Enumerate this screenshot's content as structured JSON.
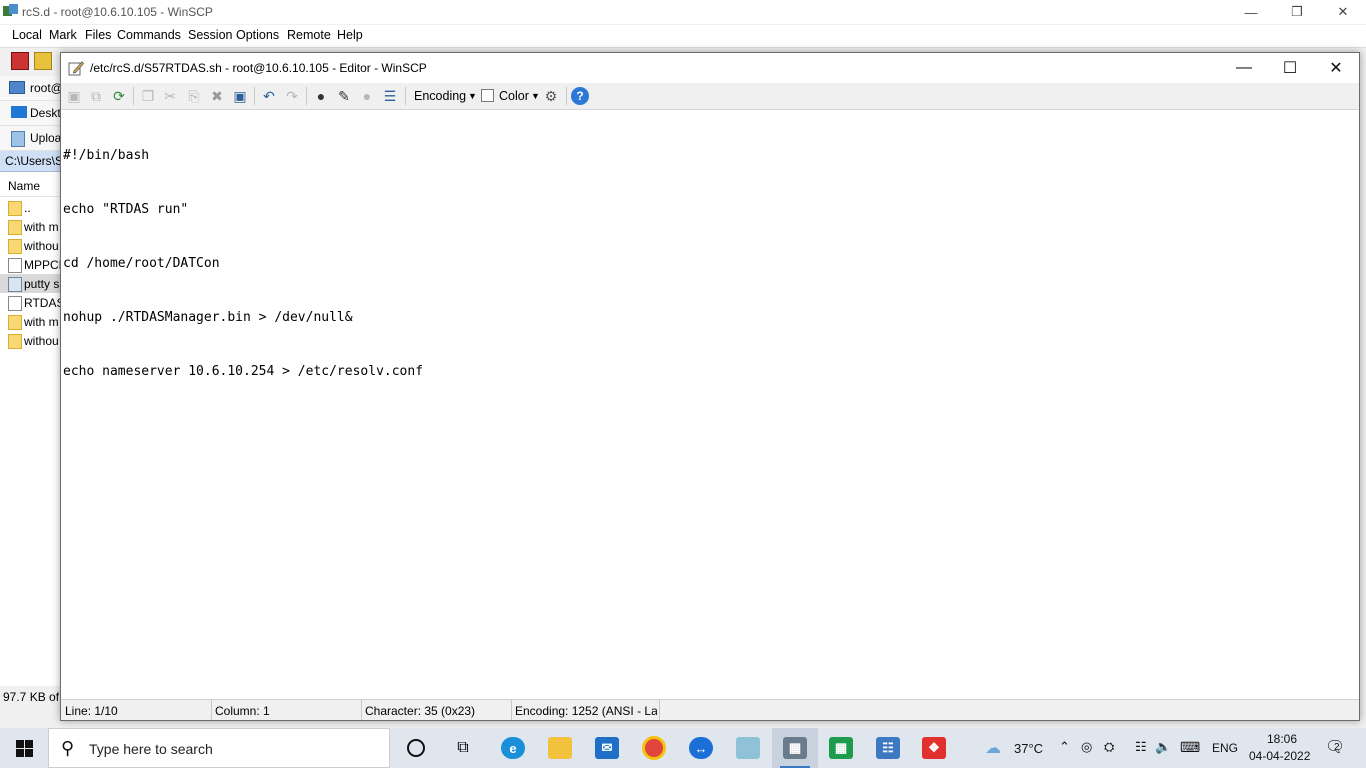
{
  "main_window": {
    "title": "rcS.d - root@10.6.10.105 - WinSCP",
    "menu": [
      "Local",
      "Mark",
      "Files",
      "Commands",
      "Session",
      "Options",
      "Remote",
      "Help"
    ],
    "left_rows": [
      "root@",
      "Deskt",
      "Uploa"
    ],
    "path": "C:\\Users\\S",
    "name_header": "Name",
    "files": [
      {
        "name": "..",
        "type": "parent"
      },
      {
        "name": "with m",
        "type": "folder"
      },
      {
        "name": "withou",
        "type": "folder"
      },
      {
        "name": "MPPCE",
        "type": "doc"
      },
      {
        "name": "putty s",
        "type": "img"
      },
      {
        "name": "RTDAS",
        "type": "doc"
      },
      {
        "name": "with m",
        "type": "zip"
      },
      {
        "name": "withou",
        "type": "zip"
      }
    ],
    "status": "97.7 KB of"
  },
  "editor": {
    "title": "/etc/rcS.d/S57RTDAS.sh - root@10.6.10.105 - Editor - WinSCP",
    "toolbar": {
      "encoding_label": "Encoding",
      "color_label": "Color"
    },
    "lines": [
      "#!/bin/bash",
      "echo \"RTDAS run\"",
      "cd /home/root/DATCon",
      "nohup ./RTDASManager.bin > /dev/null&",
      "echo nameserver 10.6.10.254 > /etc/resolv.conf"
    ],
    "status": {
      "line": "Line: 1/10",
      "column": "Column: 1",
      "character": "Character: 35 (0x23)",
      "encoding": "Encoding: 1252  (ANSI - La"
    }
  },
  "taskbar": {
    "search_placeholder": "Type here to search",
    "weather": "37°C",
    "language": "ENG",
    "time": "18:06",
    "date": "04-04-2022",
    "notification_count": "2"
  },
  "colors": {
    "accent": "#3a78c4",
    "path_bar": "#cfdff5",
    "taskbar": "#dfe6ee"
  }
}
